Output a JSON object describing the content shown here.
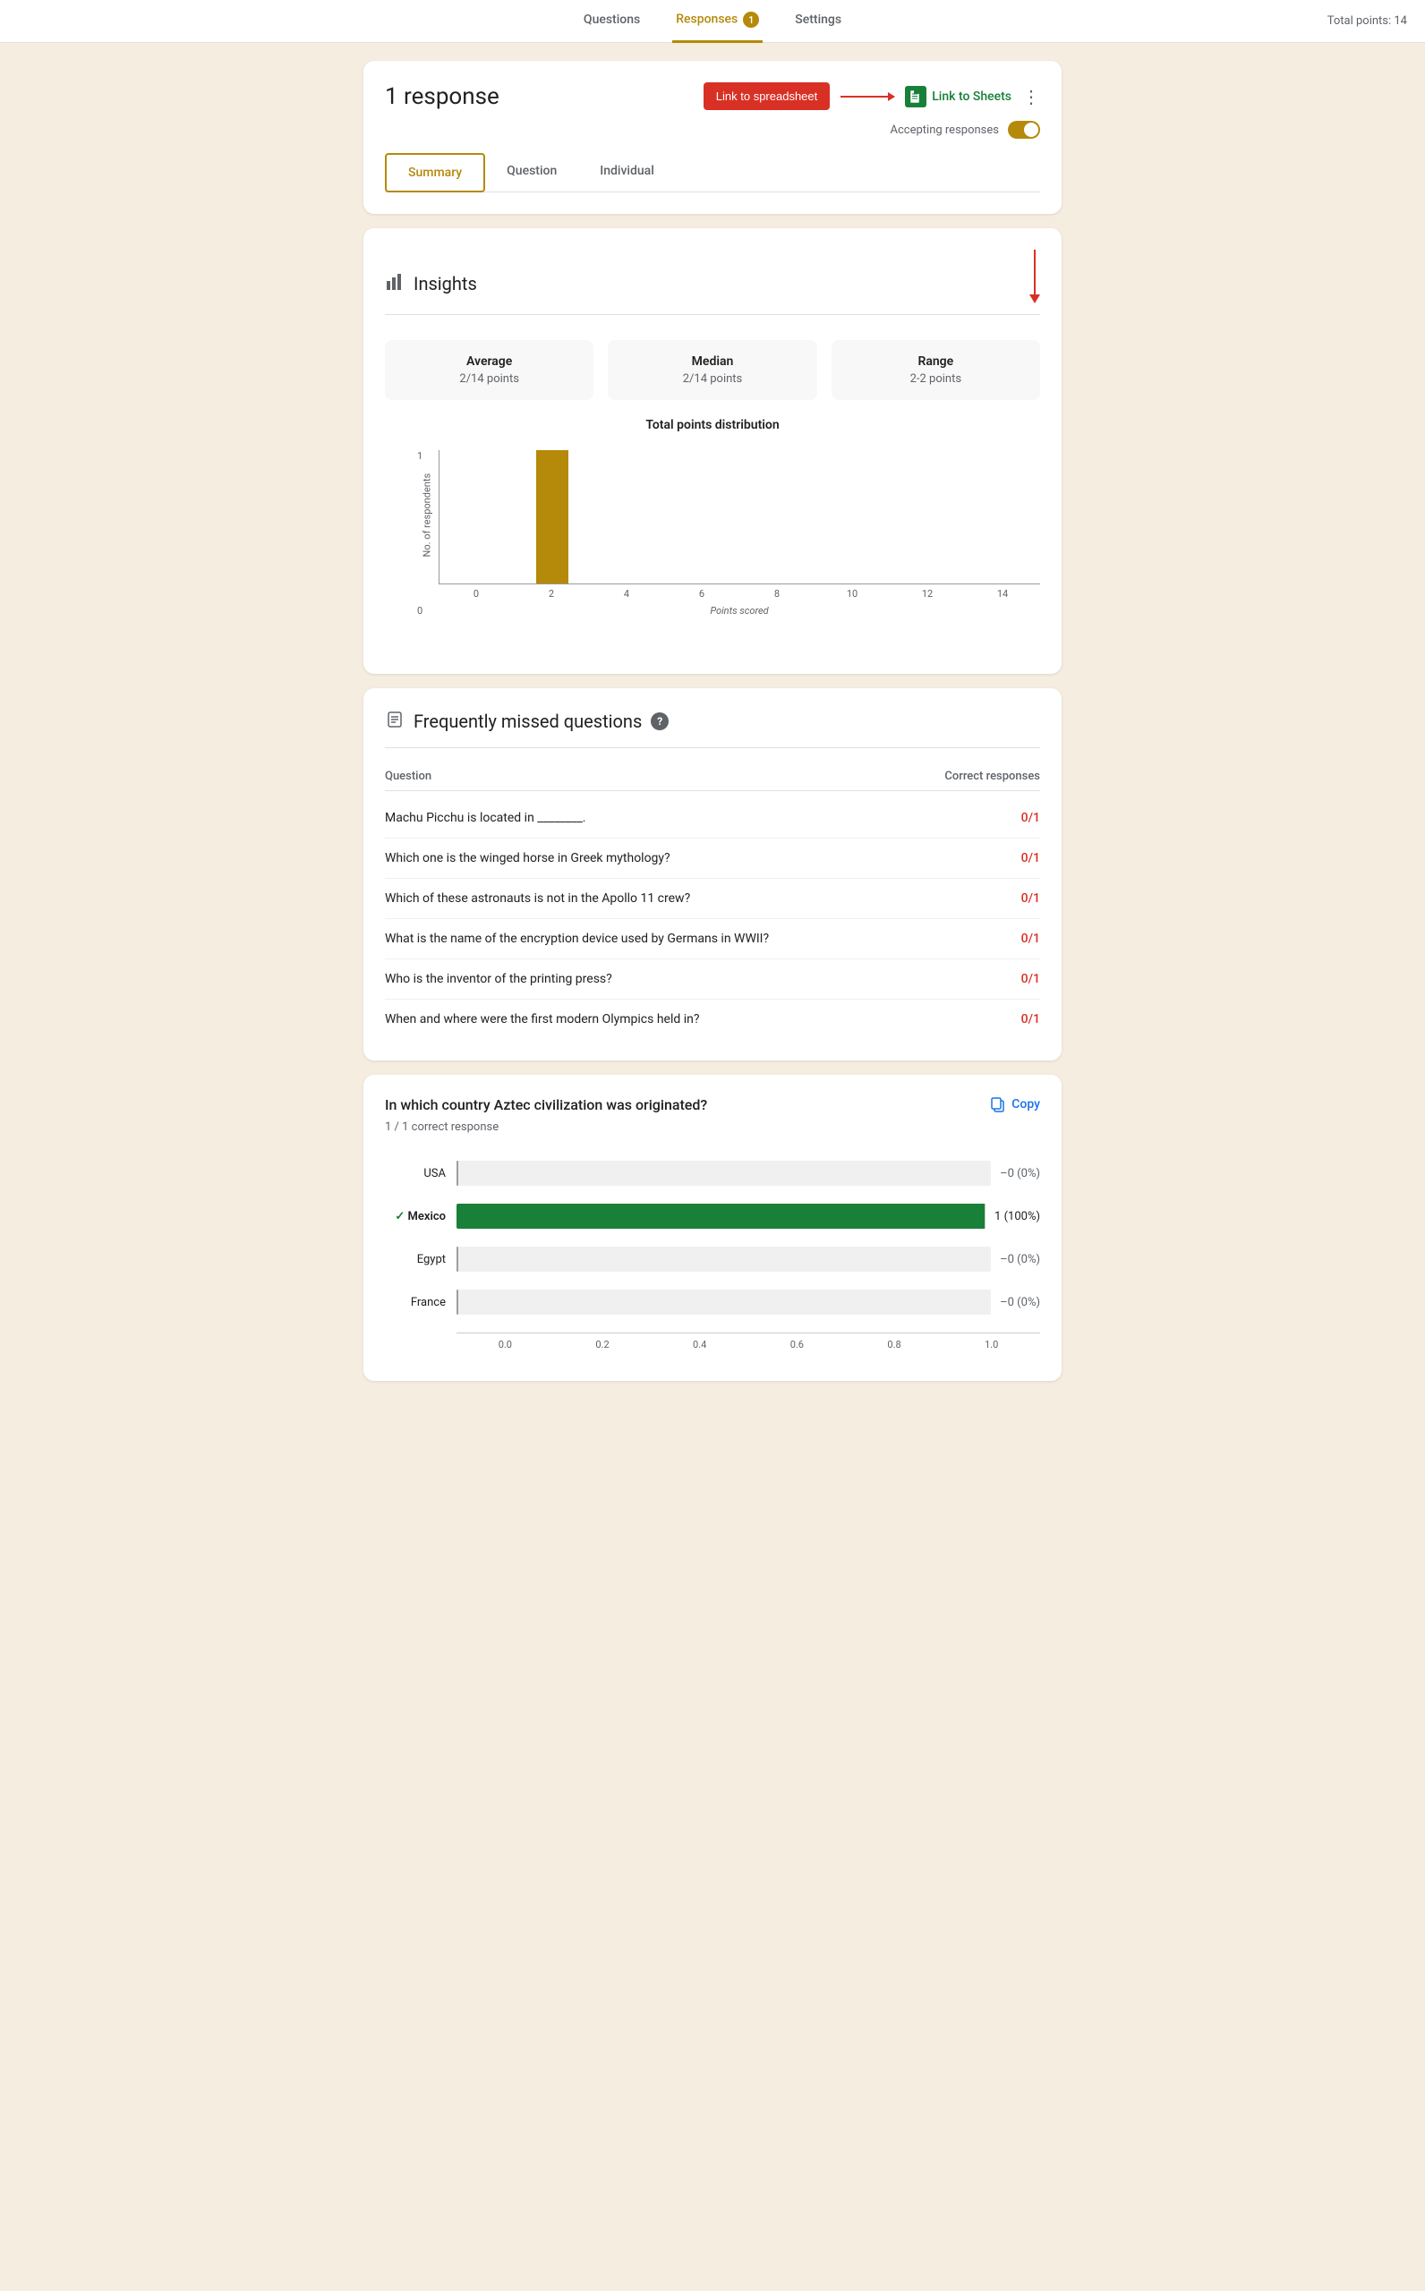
{
  "nav": {
    "tabs": [
      {
        "label": "Questions",
        "active": false
      },
      {
        "label": "Responses",
        "active": true,
        "badge": "1"
      },
      {
        "label": "Settings",
        "active": false
      }
    ],
    "total_points": "Total points: 14"
  },
  "responses_panel": {
    "title": "1 response",
    "link_spreadsheet_btn": "Link to spreadsheet",
    "link_to_sheets": "Link to Sheets",
    "more_options_icon": "⋮",
    "accepting_responses_label": "Accepting responses",
    "tabs": [
      {
        "label": "Summary",
        "active": true
      },
      {
        "label": "Question",
        "active": false
      },
      {
        "label": "Individual",
        "active": false
      }
    ]
  },
  "insights": {
    "title": "Insights",
    "stats": [
      {
        "label": "Average",
        "value": "2/14 points"
      },
      {
        "label": "Median",
        "value": "2/14 points"
      },
      {
        "label": "Range",
        "value": "2-2 points"
      }
    ],
    "chart": {
      "title": "Total points distribution",
      "y_axis_label": "No. of respondents",
      "x_axis_label": "Points scored",
      "y_max": 1,
      "y_min": 0,
      "x_labels": [
        "0",
        "2",
        "4",
        "6",
        "8",
        "10",
        "12",
        "14"
      ],
      "bar_at_x2_height_pct": 100
    }
  },
  "frequently_missed": {
    "title": "Frequently missed questions",
    "col_question": "Question",
    "col_correct": "Correct responses",
    "questions": [
      {
        "text": "Machu Picchu is located in ________.",
        "score": "0/1"
      },
      {
        "text": "Which one is the winged horse in Greek mythology?",
        "score": "0/1"
      },
      {
        "text": "Which of these astronauts is not in the Apollo 11 crew?",
        "score": "0/1"
      },
      {
        "text": "What is the name of the encryption device used by Germans in WWII?",
        "score": "0/1"
      },
      {
        "text": "Who is the inventor of the printing press?",
        "score": "0/1"
      },
      {
        "text": "When and where were the first modern Olympics held in?",
        "score": "0/1"
      }
    ]
  },
  "question_card": {
    "text": "In which country Aztec civilization was originated?",
    "copy_label": "Copy",
    "correct_count": "1 / 1 correct response",
    "options": [
      {
        "label": "USA",
        "correct": false,
        "value": 0,
        "pct": "0 (0%)"
      },
      {
        "label": "Mexico",
        "correct": true,
        "value": 1,
        "pct": "1 (100%)"
      },
      {
        "label": "Egypt",
        "correct": false,
        "value": 0,
        "pct": "0 (0%)"
      },
      {
        "label": "France",
        "correct": false,
        "value": 0,
        "pct": "0 (0%)"
      }
    ],
    "x_labels": [
      "0.0",
      "0.2",
      "0.4",
      "0.6",
      "0.8",
      "1.0"
    ]
  }
}
